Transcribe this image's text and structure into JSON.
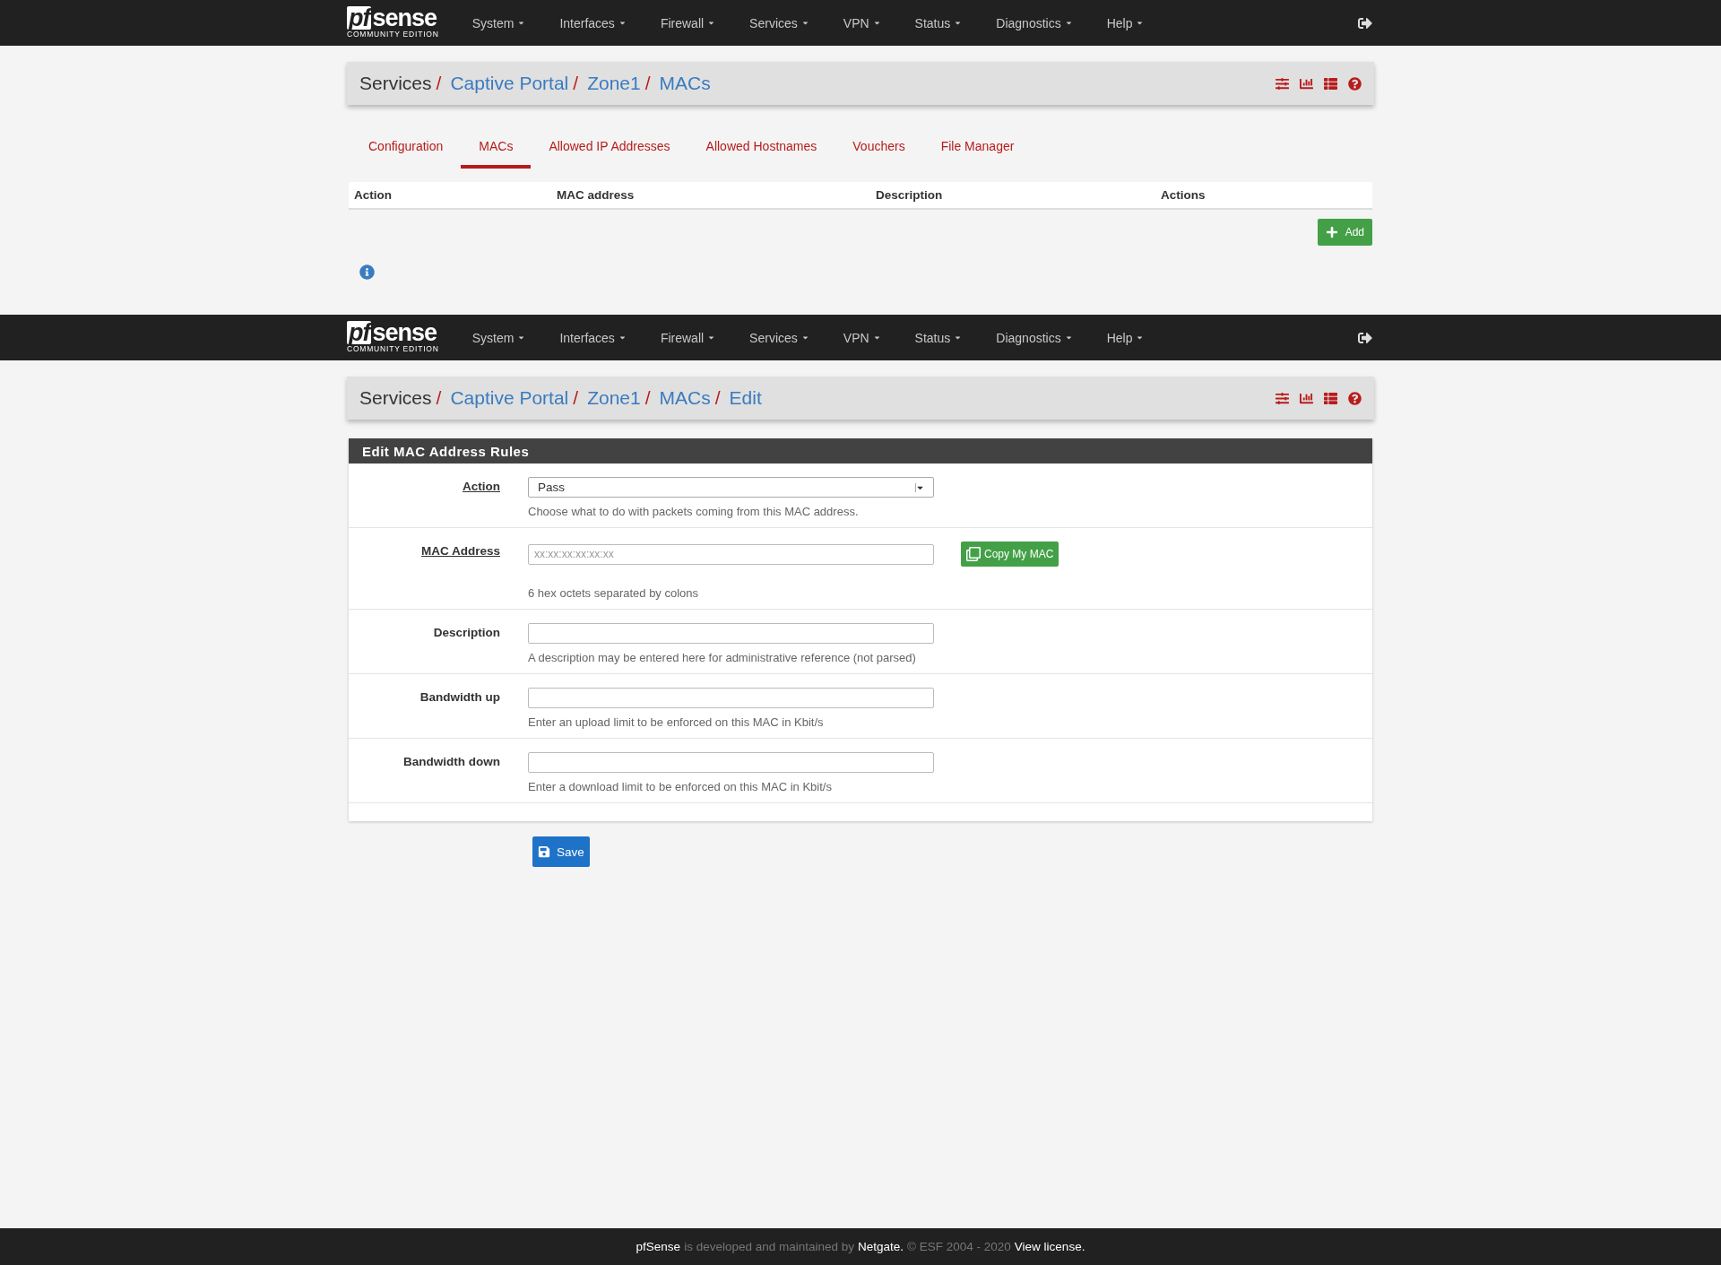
{
  "list_page": {
    "navbar": {
      "logo": {
        "prefix": "pf",
        "name": "sense",
        "edition": "COMMUNITY EDITION"
      },
      "menus": [
        {
          "label": "System"
        },
        {
          "label": "Interfaces"
        },
        {
          "label": "Firewall"
        },
        {
          "label": "Services"
        },
        {
          "label": "VPN"
        },
        {
          "label": "Status"
        },
        {
          "label": "Diagnostics"
        },
        {
          "label": "Help"
        }
      ]
    },
    "breadcrumb": [
      {
        "label": "Services",
        "link": false,
        "separator": "/"
      },
      {
        "label": "Captive Portal",
        "link": true,
        "separator": "/"
      },
      {
        "label": "Zone1",
        "link": true,
        "separator": "/"
      },
      {
        "label": "MACs",
        "link": true
      }
    ],
    "tabs": [
      {
        "label": "Configuration",
        "selected": false
      },
      {
        "label": "MACs",
        "selected": true
      },
      {
        "label": "Allowed IP Addresses",
        "selected": false
      },
      {
        "label": "Allowed Hostnames",
        "selected": false
      },
      {
        "label": "Vouchers",
        "selected": false
      },
      {
        "label": "File Manager",
        "selected": false
      }
    ],
    "table": {
      "columns": [
        "Action",
        "MAC address",
        "Description",
        "Actions"
      ]
    },
    "add_button": "Add"
  },
  "edit_page": {
    "navbar": {
      "logo": {
        "prefix": "pf",
        "name": "sense",
        "edition": "COMMUNITY EDITION"
      },
      "menus": [
        {
          "label": "System"
        },
        {
          "label": "Interfaces"
        },
        {
          "label": "Firewall"
        },
        {
          "label": "Services"
        },
        {
          "label": "VPN"
        },
        {
          "label": "Status"
        },
        {
          "label": "Diagnostics"
        },
        {
          "label": "Help"
        }
      ]
    },
    "breadcrumb": [
      {
        "label": "Services",
        "link": false,
        "separator": "/"
      },
      {
        "label": "Captive Portal",
        "link": true,
        "separator": "/"
      },
      {
        "label": "Zone1",
        "link": true,
        "separator": "/"
      },
      {
        "label": "MACs",
        "link": true,
        "separator": "/"
      },
      {
        "label": "Edit",
        "link": true
      }
    ],
    "panel": {
      "title": "Edit MAC Address Rules",
      "fields": [
        {
          "kind": "select",
          "label": "Action",
          "help_link": true,
          "value": "Pass",
          "hint": "Choose what to do with packets coming from this MAC address."
        },
        {
          "kind": "text",
          "label": "MAC Address",
          "help_link": true,
          "placeholder": "xx:xx:xx:xx:xx:xx",
          "button": "Copy My MAC",
          "hint": "6 hex octets separated by colons"
        },
        {
          "kind": "text",
          "label": "Description",
          "help_link": false,
          "hint": "A description may be entered here for administrative reference (not parsed)"
        },
        {
          "kind": "text",
          "label": "Bandwidth up",
          "help_link": false,
          "hint": "Enter an upload limit to be enforced on this MAC in Kbit/s"
        },
        {
          "kind": "text",
          "label": "Bandwidth down",
          "help_link": false,
          "hint": "Enter a download limit to be enforced on this MAC in Kbit/s"
        }
      ]
    },
    "save_button": "Save"
  },
  "footer": [
    {
      "text": "pfSense",
      "emphasis": true
    },
    {
      "text": "is developed and maintained by",
      "emphasis": false
    },
    {
      "text": "Netgate.",
      "emphasis": true
    },
    {
      "text": "© ESF 2004 - 2020",
      "emphasis": false
    },
    {
      "text": "View license.",
      "emphasis": true
    }
  ]
}
